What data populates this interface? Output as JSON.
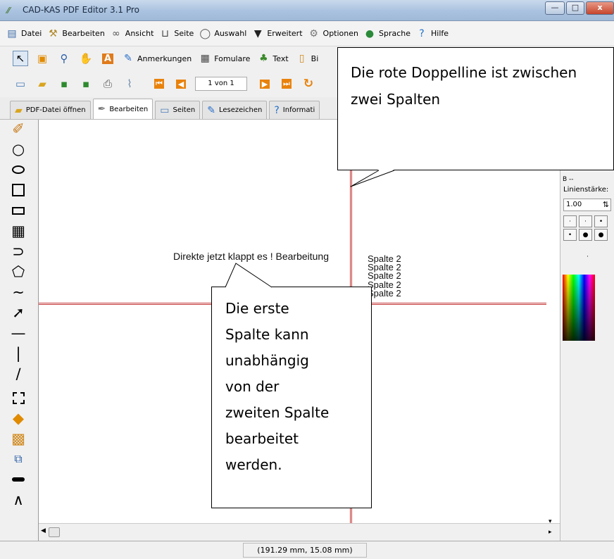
{
  "window": {
    "title": "CAD-KAS PDF Editor 3.1 Pro",
    "minimize": "—",
    "maximize": "□",
    "close": "x"
  },
  "menu": [
    "Datei",
    "Bearbeiten",
    "Ansicht",
    "Seite",
    "Auswahl",
    "Erweitert",
    "Optionen",
    "Sprache",
    "Hilfe"
  ],
  "toolbar1": {
    "annotations": "Anmerkungen",
    "forms": "Fomulare",
    "text": "Text",
    "images": "Bi"
  },
  "toolbar2": {
    "page_display": "1 von 1"
  },
  "tabs": [
    "PDF-Datei öffnen",
    "Bearbeiten",
    "Seiten",
    "Lesezeichen",
    "Informati"
  ],
  "document": {
    "column1_text": "Direkte jetzt klappt es ! Bearbeitung",
    "column2_lines": [
      "Spalte 2",
      "Spalte 2",
      "Spalte 2",
      "Spalte 2",
      "Spalte 2"
    ]
  },
  "right_panel": {
    "truncated_label": "B --",
    "line_width_label": "Linienstärke:",
    "line_width_value": "1.00",
    "extra_dot": "·"
  },
  "status": {
    "coordinates": "(191.29 mm, 15.08 mm)"
  },
  "callouts": {
    "top": [
      "Die rote Doppelline ist zwischen",
      "zwei Spalten"
    ],
    "middle": [
      "Die erste",
      "Spalte kann",
      "unabhängig",
      "von der",
      "zweiten Spalte",
      "bearbeitet",
      "werden."
    ]
  },
  "icons": {
    "menu": [
      "document-icon",
      "hammer-icon",
      "binoculars-icon",
      "book-icon",
      "lasso-icon",
      "mortarboard-icon",
      "wrench-icon",
      "globe-icon",
      "help-icon"
    ],
    "left_tools": [
      "brush-icon",
      "circle-icon",
      "ellipse-icon",
      "square-icon",
      "rectangle-icon",
      "grid-icon",
      "polyline-icon",
      "polygon-icon",
      "curve-icon",
      "arrow-icon",
      "horizontal-line-icon",
      "vertical-line-icon",
      "diagonal-line-icon",
      "selection-icon",
      "eraser-icon",
      "fill-icon",
      "transform-icon",
      "thick-line-icon",
      "caret-icon"
    ]
  },
  "colors": {
    "red_line": "#c43a3a",
    "titlebar": "#a9c2df"
  }
}
